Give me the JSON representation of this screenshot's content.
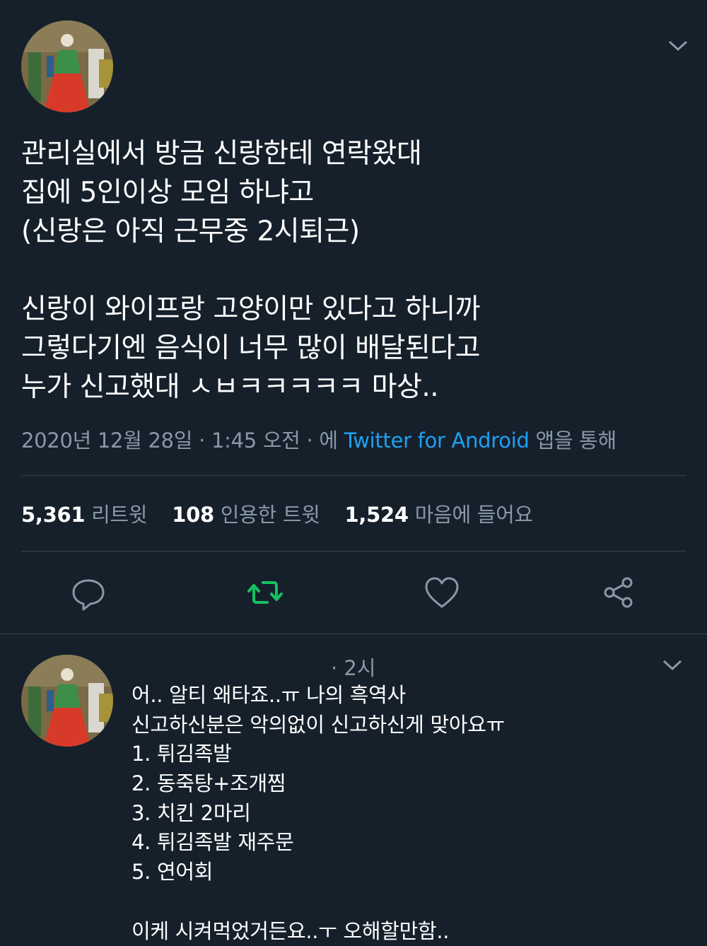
{
  "tweet": {
    "lines": [
      "관리실에서 방금 신랑한테 연락왔대",
      "집에 5인이상 모임 하냐고",
      "(신랑은 아직 근무중 2시퇴근)",
      "",
      "신랑이 와이프랑 고양이만 있다고 하니까",
      "그렇다기엔 음식이 너무 많이 배달된다고",
      "누가 신고했대 ㅅㅂㅋㅋㅋㅋㅋ 마상.."
    ],
    "date": "2020년 12월 28일",
    "time": "1:45 오전",
    "via_prefix": "에",
    "source": "Twitter for Android",
    "via_suffix": "앱을 통해"
  },
  "stats": {
    "retweets_count": "5,361",
    "retweets_label": "리트윗",
    "quotes_count": "108",
    "quotes_label": "인용한 트윗",
    "likes_count": "1,524",
    "likes_label": "마음에 들어요"
  },
  "actions": {
    "reply_icon": "reply-icon",
    "retweet_icon": "retweet-icon",
    "like_icon": "heart-icon",
    "share_icon": "share-icon",
    "retweet_active_color": "#17bf63"
  },
  "reply": {
    "time": "· 2시",
    "lines": [
      "어.. 알티 왜타죠..ㅠ 나의 흑역사",
      "신고하신분은 악의없이 신고하신게 맞아요ㅠ",
      "1. 튀김족발",
      "2. 동죽탕+조개찜",
      "3. 치킨 2마리",
      "4. 튀김족발 재주문",
      "5. 연어회",
      "",
      "이케 시켜먹었거든요..ㅜ 오해할만함.."
    ]
  },
  "colors": {
    "background": "#15202b",
    "text": "#ffffff",
    "muted": "#8899a6",
    "link": "#1da1f2",
    "divider": "#38444d"
  }
}
